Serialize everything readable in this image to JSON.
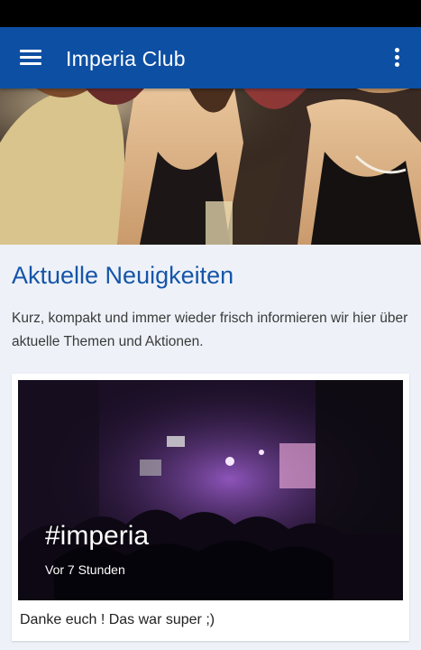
{
  "app_bar": {
    "title": "Imperia Club",
    "menu_icon": "hamburger-menu-icon",
    "more_icon": "more-vertical-icon",
    "color": "#0d4fa3"
  },
  "hero": {
    "image": "party-crowd-photo"
  },
  "news": {
    "title": "Aktuelle Neuigkeiten",
    "intro": "Kurz, kompakt und immer wieder frisch informieren wir hier über aktuelle Themen und Aktionen.",
    "title_color": "#1655a8",
    "items": [
      {
        "title": "#imperia",
        "time": "Vor 7 Stunden",
        "text": "Danke euch ! Das war super ;)",
        "image": "club-dancefloor-photo"
      }
    ]
  }
}
